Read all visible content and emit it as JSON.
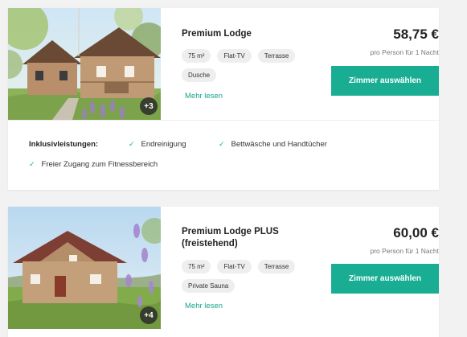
{
  "colors": {
    "accent": "#19ae93",
    "link": "#17a58a",
    "tag_bg": "#eeeeee",
    "page_bg": "#f2f2f2"
  },
  "rooms": [
    {
      "title": "Premium Lodge",
      "image_count_badge": "+3",
      "tags": [
        "75 m²",
        "Flat-TV",
        "Terrasse",
        "Dusche"
      ],
      "more_link": "Mehr lesen",
      "price": "58,75 €",
      "price_sub": "pro Person für 1 Nacht",
      "select_label": "Zimmer auswählen",
      "inclusions": {
        "label": "Inklusivleistungen:",
        "items": [
          "Endreinigung",
          "Bettwäsche und Handtücher",
          "Freier Zugang zum Fitnessbereich"
        ]
      }
    },
    {
      "title": "Premium Lodge PLUS (freistehend)",
      "image_count_badge": "+4",
      "tags": [
        "75 m²",
        "Flat-TV",
        "Terrasse",
        "Private Sauna"
      ],
      "more_link": "Mehr lesen",
      "price": "60,00 €",
      "price_sub": "pro Person für 1 Nacht",
      "select_label": "Zimmer auswählen"
    }
  ]
}
